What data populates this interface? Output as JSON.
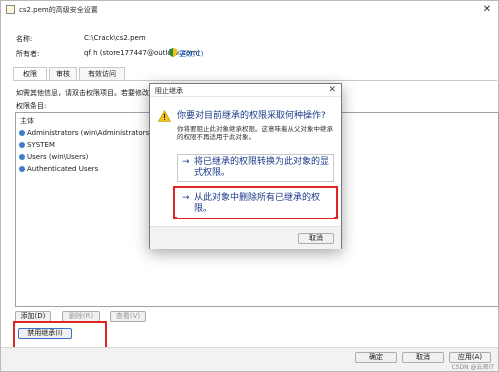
{
  "window": {
    "title": "cs2.pem的高级安全设置",
    "close_glyph": "✕"
  },
  "info": {
    "name_label": "名称:",
    "name_value": "C:\\Crack\\cs2.pem",
    "owner_label": "所有者:",
    "owner_value": "qf h (store177447@outlook.com)",
    "change_link": "更改(C)"
  },
  "tabs": [
    {
      "label": "权限",
      "active": true
    },
    {
      "label": "审核",
      "active": false
    },
    {
      "label": "有效访问",
      "active": false
    }
  ],
  "instructions": "如需其他信息，请双击权限项目。若要修改",
  "perm_entries_label": "权限条目:",
  "perm_list": {
    "header": "主体",
    "rows": [
      "Administrators (win\\Administrators)",
      "SYSTEM",
      "Users (win\\Users)",
      "Authenticated Users"
    ]
  },
  "buttons": {
    "add": "添加(D)",
    "remove": "删除(R)",
    "view": "查看(V)",
    "disable_inheritance": "禁用继承(I)",
    "ok": "确定",
    "cancel": "取消",
    "apply": "应用(A)"
  },
  "dialog": {
    "title": "阻止继承",
    "close_glyph": "✕",
    "heading": "你要对目前继承的权限采取何种操作?",
    "description": "你将要阻止此对象继承权限。这意味着从父对象中继承的权限不再适用于此对象。",
    "option1": "将已继承的权限转换为此对象的显式权限。",
    "option2": "从此对象中删除所有已继承的权限。",
    "cancel": "取消",
    "arrow_glyph": "→"
  },
  "watermark": "CSDN @云肾IT",
  "colors": {
    "highlight_red": "#e02424",
    "link_blue": "#0b57c2",
    "dialog_text_blue": "#1c3a8a"
  }
}
